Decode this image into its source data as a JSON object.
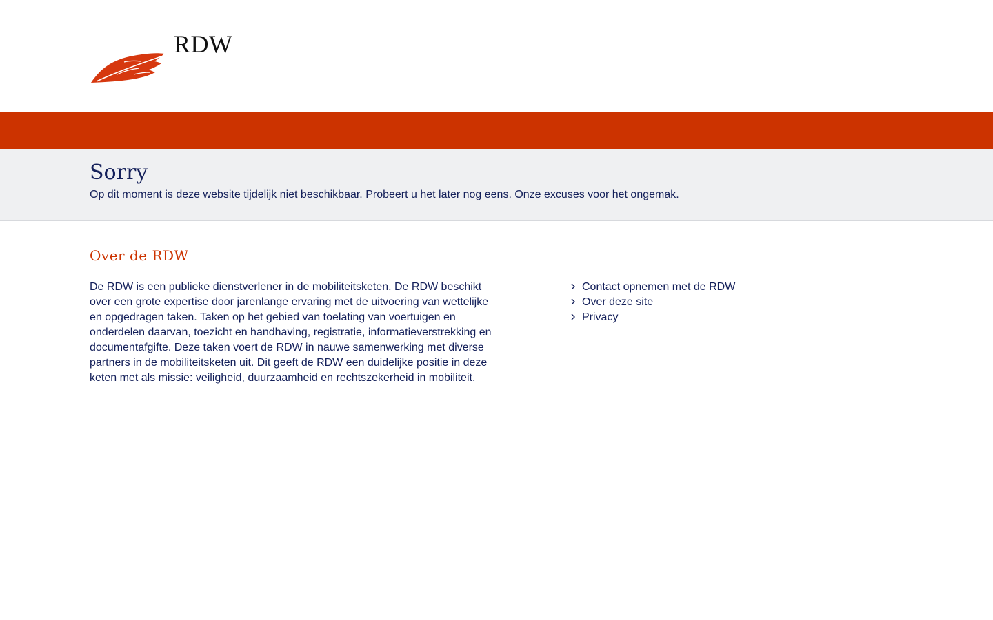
{
  "header": {
    "logo_text": "RDW",
    "logo_icon": "rdw-feather-logo-icon"
  },
  "colors": {
    "brand_orange": "#cc3300",
    "navy_text": "#14205a",
    "band_gray": "#eff0f2"
  },
  "notice": {
    "title": "Sorry",
    "message": "Op dit moment is deze website tijdelijk niet beschikbaar. Probeert u het later nog eens. Onze excuses voor het ongemak."
  },
  "footer": {
    "about_title": "Over de RDW",
    "about_text": "De RDW is een publieke dienstverlener in de mobiliteitsketen. De RDW beschikt over een grote expertise door jarenlange ervaring met de uitvoering van wettelijke en opgedragen taken. Taken op het gebied van toelating van voertuigen en onderdelen daarvan, toezicht en handhaving, registratie, informatieverstrekking en documentafgifte. Deze taken voert de RDW in nauwe samenwerking met diverse partners in de mobiliteitsketen uit. Dit geeft de RDW een duidelijke positie in deze keten met als missie: veiligheid, duurzaamheid en rechtszekerheid in mobiliteit.",
    "links": [
      {
        "label": "Contact opnemen met de RDW",
        "icon": "chevron-right-icon"
      },
      {
        "label": "Over deze site",
        "icon": "chevron-right-icon"
      },
      {
        "label": "Privacy",
        "icon": "chevron-right-icon"
      }
    ]
  }
}
